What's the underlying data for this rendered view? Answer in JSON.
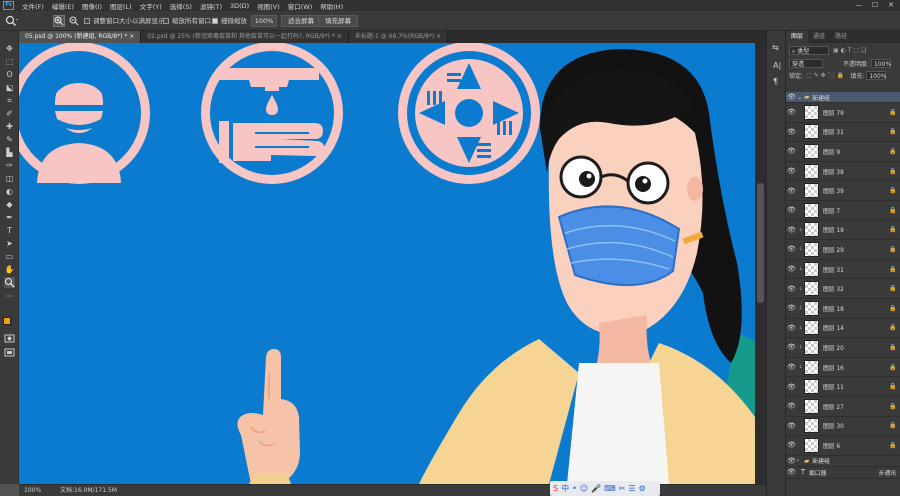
{
  "menubar": {
    "logo": "Ps",
    "items": [
      "文件(F)",
      "编辑(E)",
      "图像(I)",
      "图层(L)",
      "文字(Y)",
      "选择(S)",
      "滤镜(T)",
      "3D(D)",
      "视图(V)",
      "窗口(W)",
      "帮助(H)"
    ],
    "minimize": "—",
    "maximize": "☐",
    "close": "✕"
  },
  "options": {
    "tool_icon": "zoom-icon",
    "resize_label": "调整窗口大小以满屏显示",
    "zoom_all_label": "缩放所有窗口",
    "scrubby_label": "细微缩放",
    "zoom_value": "100%",
    "fit_screen": "适合屏幕",
    "fill_screen": "填充屏幕"
  },
  "tabs": [
    {
      "label": "05.psd @ 100% (新建组, RGB/8*) *",
      "active": true
    },
    {
      "label": "02.psd @ 25% (新冠病毒疫苗和 其他疫苗可以一起打吗?, RGB/8*) *",
      "active": false
    },
    {
      "label": "未标题-1 @ 66.7%(RGB/8*)",
      "active": false
    }
  ],
  "tab_close": "×",
  "tools": [
    "✥",
    "⬚",
    "ʘ",
    "⬕",
    "⌗",
    "✐",
    "✚",
    "✎",
    "▙",
    "✑",
    "◫",
    "◐",
    "◆",
    "✒",
    "T",
    "➤",
    "▭",
    "✋",
    "🔍",
    "···"
  ],
  "colors": {
    "foreground": "#f2a114",
    "background": "#ffffff",
    "canvas_bg": "#0b7bd0",
    "pink": "#f7c6c4"
  },
  "status": {
    "zoom": "100%",
    "doc": "文档:16.0M/171.5M"
  },
  "layers_panel": {
    "tabs": [
      "图层",
      "通道",
      "路径"
    ],
    "filter_label": "类型",
    "blend_mode": "穿透",
    "opacity_label": "不透明度:",
    "opacity_value": "100%",
    "lock_label": "锁定:",
    "fill_label": "填充:",
    "fill_value": "100%",
    "group_name": "新建组",
    "layers": [
      {
        "name": "图层 79",
        "clip": false
      },
      {
        "name": "图层 31",
        "clip": false
      },
      {
        "name": "图层 9",
        "clip": false
      },
      {
        "name": "图层 38",
        "clip": false
      },
      {
        "name": "图层 39",
        "clip": false
      },
      {
        "name": "图层 7",
        "clip": false
      },
      {
        "name": "图层 19",
        "clip": true
      },
      {
        "name": "图层 29",
        "clip": true
      },
      {
        "name": "图层 31",
        "clip": true
      },
      {
        "name": "图层 32",
        "clip": true
      },
      {
        "name": "图层 18",
        "clip": true
      },
      {
        "name": "图层 14",
        "clip": true
      },
      {
        "name": "图层 20",
        "clip": true
      },
      {
        "name": "图层 16",
        "clip": true
      },
      {
        "name": "图层 11",
        "clip": false
      },
      {
        "name": "图层 27",
        "clip": false
      },
      {
        "name": "图层 30",
        "clip": false
      },
      {
        "name": "图层 6",
        "clip": false
      }
    ],
    "group2_name": "新建组",
    "bottom_layer": "截口器",
    "bottom_layer_extra": "步通讯"
  },
  "taskbar_icons": [
    "S",
    "中",
    "•",
    "☺",
    "🎤",
    "⌨",
    "✂",
    "☰",
    "⚙"
  ]
}
